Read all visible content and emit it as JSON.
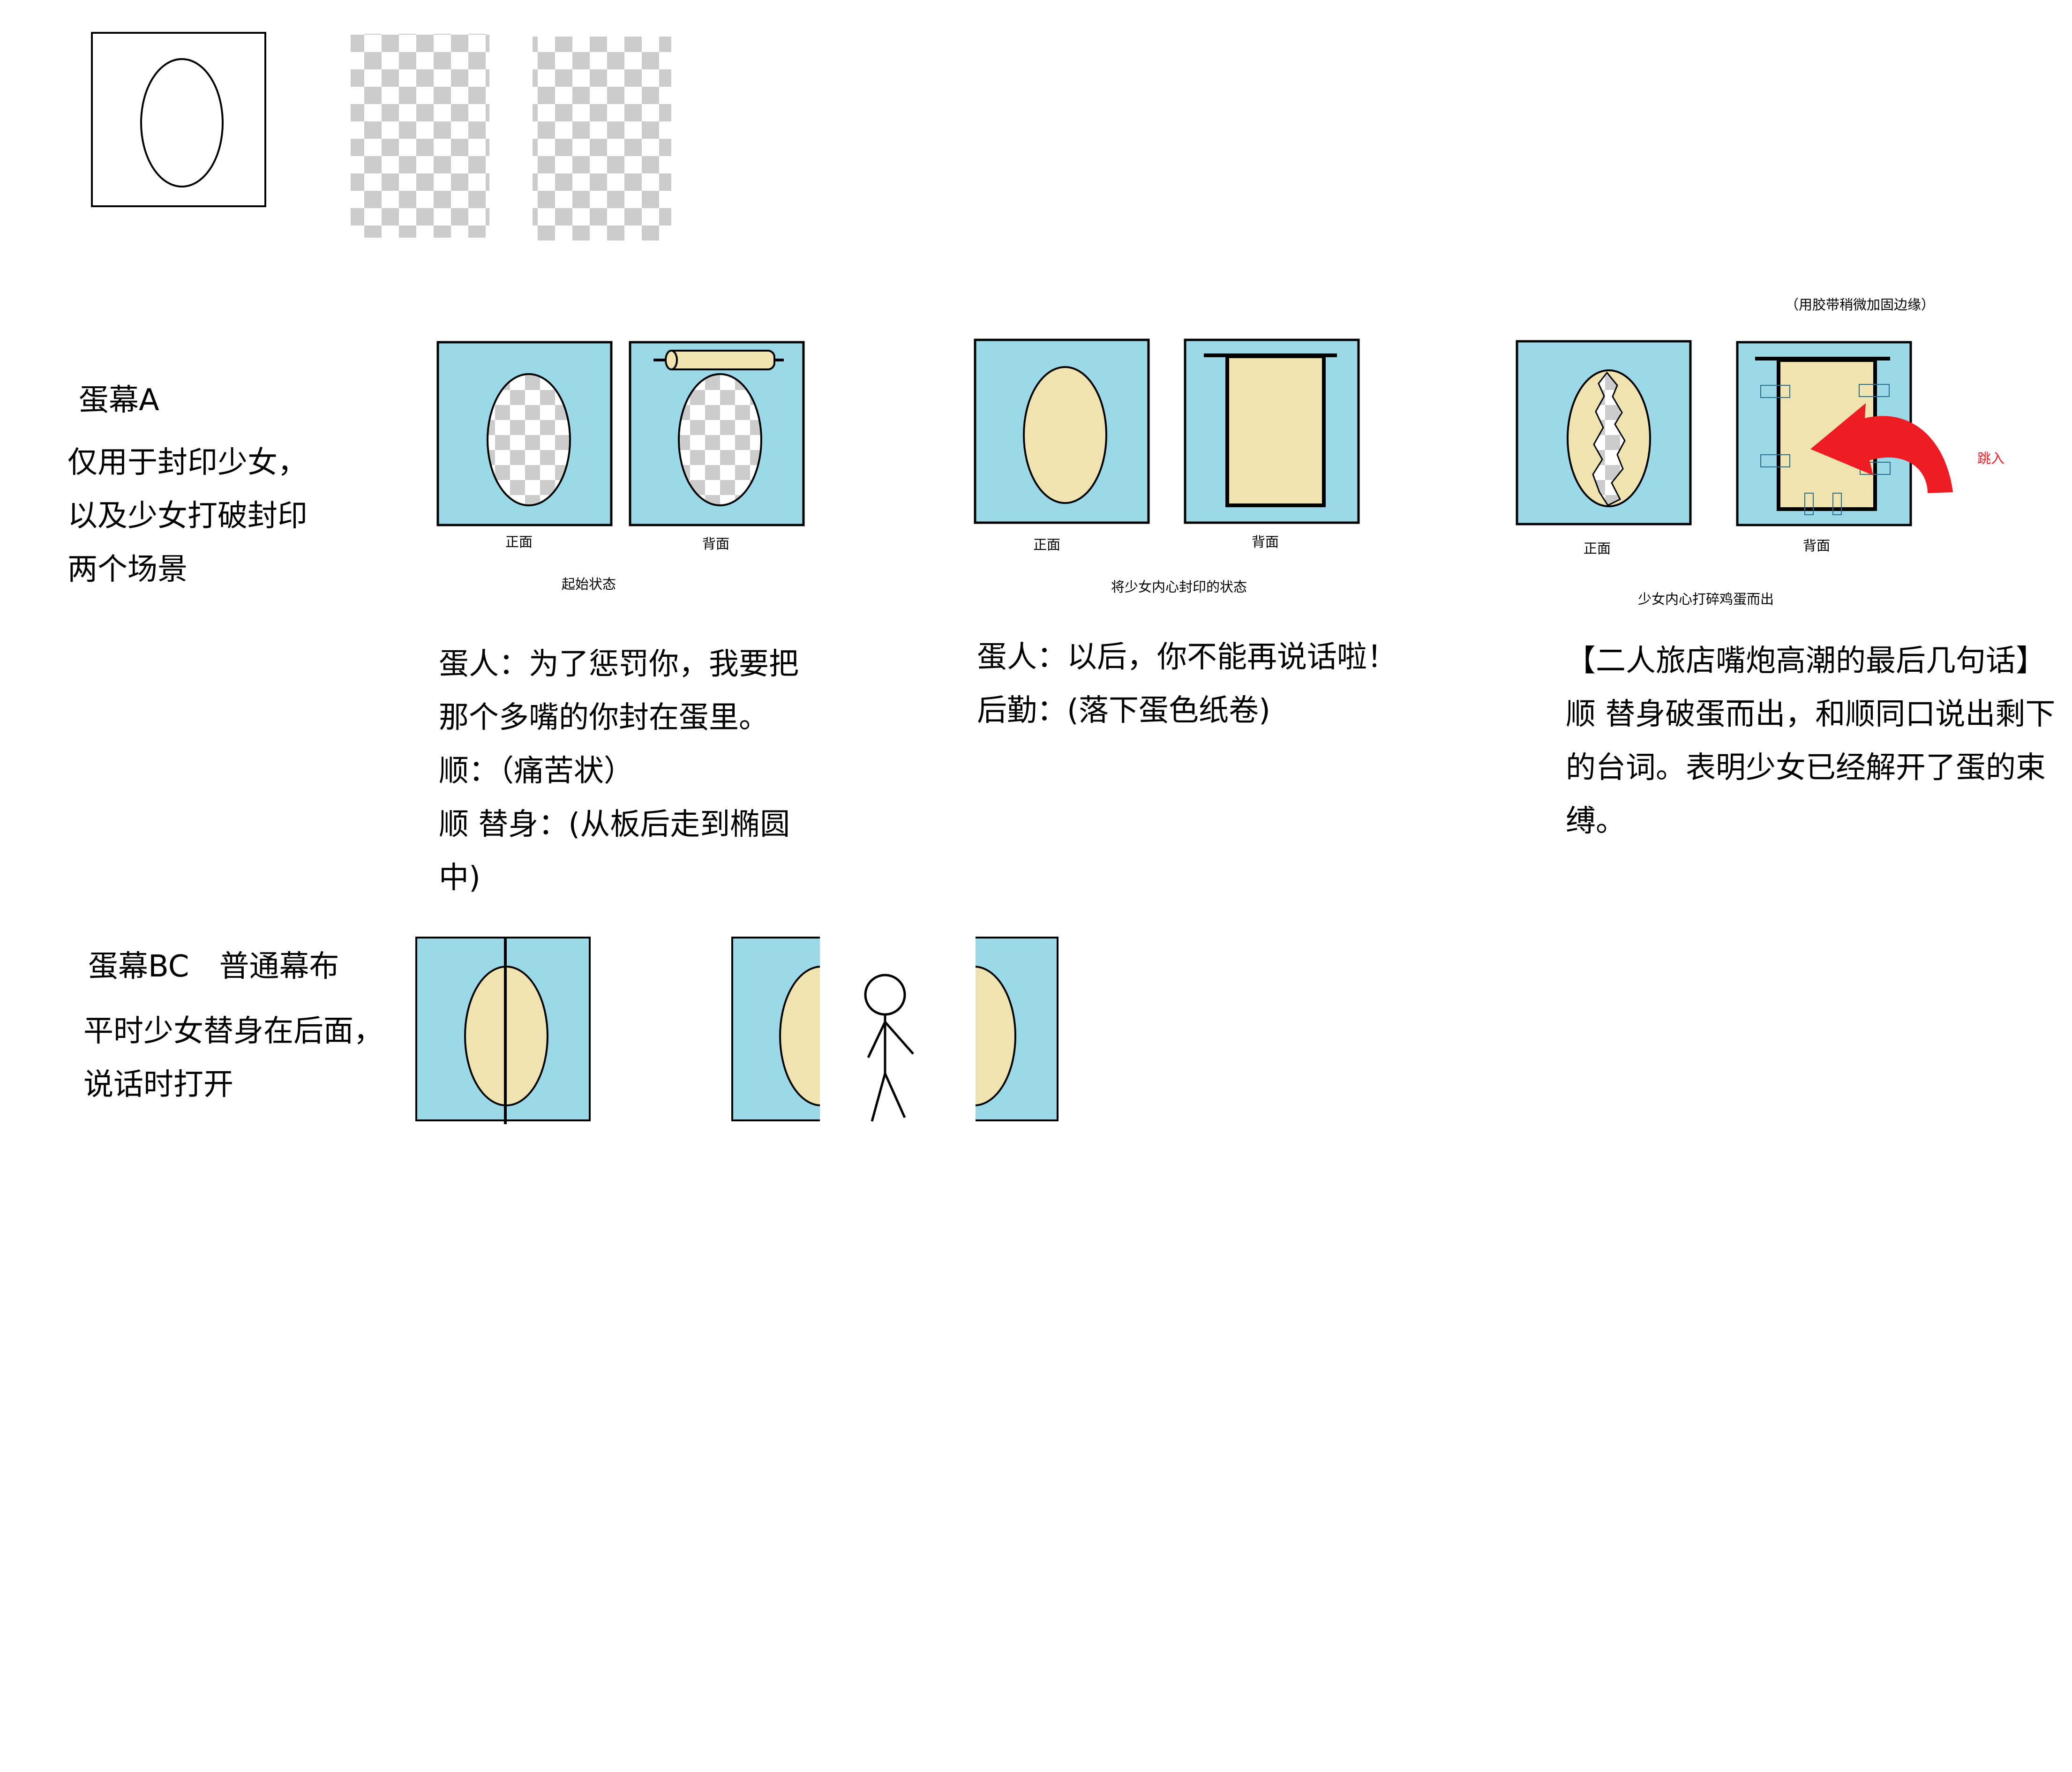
{
  "colors": {
    "panel": "#9bd8e8",
    "egg": "#efe4b0",
    "checker_dark": "#cccccc",
    "checker_light": "#ffffff",
    "arrow": "#ee1c25",
    "stroke": "#000000"
  },
  "section_a": {
    "title": "蛋幕A",
    "description": [
      "仅用于封印少女，",
      "以及少女打破封印",
      "两个场景"
    ],
    "stage1": {
      "front_label": "正面",
      "back_label": "背面",
      "caption": "起始状态",
      "dialogue": [
        "蛋人：为了惩罚你，我要把",
        "那个多嘴的你封在蛋里。",
        "顺：（痛苦状）",
        "顺 替身：(从板后走到椭圆",
        "中)"
      ]
    },
    "stage2": {
      "front_label": "正面",
      "back_label": "背面",
      "caption": "将少女内心封印的状态",
      "dialogue": [
        "蛋人：以后，你不能再说话啦！",
        "后勤：(落下蛋色纸卷)"
      ]
    },
    "stage3": {
      "note": "（用胶带稍微加固边缘）",
      "front_label": "正面",
      "back_label": "背面",
      "arrow_label": "跳入",
      "caption": "少女内心打碎鸡蛋而出",
      "dialogue": [
        "【二人旅店嘴炮高潮的最后几句话】",
        "顺 替身破蛋而出，和顺同口说出剩下",
        "的台词。表明少女已经解开了蛋的束",
        "缚。"
      ]
    }
  },
  "section_bc": {
    "title": "蛋幕BC　普通幕布",
    "description": [
      "平时少女替身在后面，",
      "说话时打开"
    ]
  }
}
